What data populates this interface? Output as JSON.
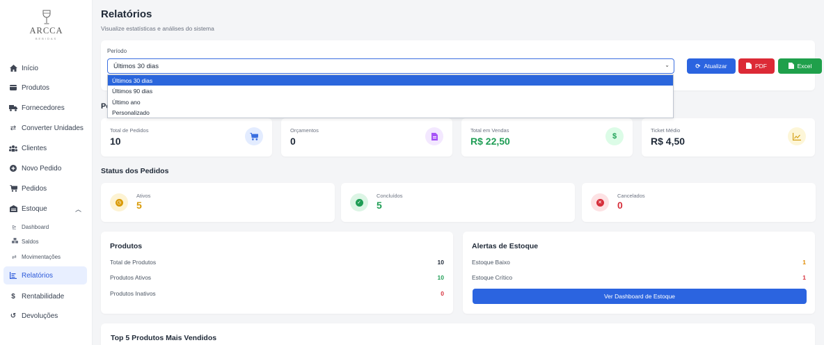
{
  "brand": {
    "name": "ARCCA",
    "tagline": "BEBIDAS"
  },
  "sidebar": {
    "items": [
      {
        "label": "Início",
        "icon": "home-icon"
      },
      {
        "label": "Produtos",
        "icon": "box-icon"
      },
      {
        "label": "Fornecedores",
        "icon": "truck-icon"
      },
      {
        "label": "Converter Unidades",
        "icon": "swap-icon"
      },
      {
        "label": "Clientes",
        "icon": "users-icon"
      },
      {
        "label": "Novo Pedido",
        "icon": "plus-circle-icon"
      },
      {
        "label": "Pedidos",
        "icon": "cart-icon"
      },
      {
        "label": "Estoque",
        "icon": "warehouse-icon"
      },
      {
        "label": "Relatórios",
        "icon": "report-icon"
      },
      {
        "label": "Rentabilidade",
        "icon": "dollar-icon"
      },
      {
        "label": "Devoluções",
        "icon": "undo-icon"
      }
    ],
    "sub_items": [
      {
        "label": "Dashboard",
        "icon": "chart-icon"
      },
      {
        "label": "Saldos",
        "icon": "boxes-icon"
      },
      {
        "label": "Movimentações",
        "icon": "swap-icon"
      }
    ]
  },
  "header": {
    "title": "Relatórios",
    "subtitle": "Visualize estatísticas e análises do sistema"
  },
  "filter": {
    "label": "Período",
    "selected": "Últimos 30 dias",
    "options": [
      "Últimos 30 dias",
      "Últimos 90 dias",
      "Último ano",
      "Personalizado"
    ],
    "buttons": {
      "refresh": "Atualizar",
      "pdf": "PDF",
      "excel": "Excel"
    }
  },
  "period_section_peek": "Pe",
  "stats": [
    {
      "label": "Total de Pedidos",
      "value": "10",
      "icon": "cart-icon",
      "color": "#3b6fe0",
      "bg": "#e3ecff"
    },
    {
      "label": "Orçamentos",
      "value": "0",
      "icon": "document-icon",
      "color": "#a855f7",
      "bg": "#f3e8ff"
    },
    {
      "label": "Total em Vendas",
      "value": "R$ 22,50",
      "icon": "dollar-icon",
      "color": "#22a35a",
      "bg": "#dcfce7"
    },
    {
      "label": "Ticket Médio",
      "value": "R$ 4,50",
      "icon": "chart-line-icon",
      "color": "#d4a017",
      "bg": "#fdf6d8"
    }
  ],
  "status": {
    "title": "Status dos Pedidos",
    "cards": [
      {
        "label": "Ativos",
        "value": "5",
        "color": "#d99a06",
        "bg": "#fdf3d3",
        "icon": "clock-icon"
      },
      {
        "label": "Concluídos",
        "value": "5",
        "color": "#1f9d55",
        "bg": "#dcf5e5",
        "icon": "check-icon"
      },
      {
        "label": "Cancelados",
        "value": "0",
        "color": "#d6303c",
        "bg": "#fde2e4",
        "icon": "x-icon"
      }
    ]
  },
  "products": {
    "title": "Produtos",
    "rows": [
      {
        "label": "Total de Produtos",
        "value": "10",
        "color": "#1f2937"
      },
      {
        "label": "Produtos Ativos",
        "value": "10",
        "color": "#1f9d55"
      },
      {
        "label": "Produtos Inativos",
        "value": "0",
        "color": "#d6303c"
      }
    ]
  },
  "stock_alerts": {
    "title": "Alertas de Estoque",
    "rows": [
      {
        "label": "Estoque Baixo",
        "value": "1",
        "color": "#e08a00"
      },
      {
        "label": "Estoque Crítico",
        "value": "1",
        "color": "#d6303c"
      }
    ],
    "button": "Ver Dashboard de Estoque"
  },
  "top5": {
    "title": "Top 5 Produtos Mais Vendidos"
  }
}
